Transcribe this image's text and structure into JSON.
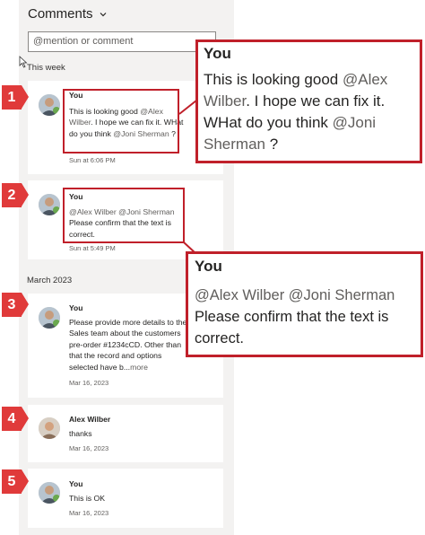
{
  "header": {
    "title": "Comments",
    "chevron_icon": "chevron-down-icon"
  },
  "search": {
    "placeholder": "@mention or comment"
  },
  "sections": {
    "this_week": "This week",
    "march_2023": "March 2023"
  },
  "comments": [
    {
      "badge": "1",
      "author": "You",
      "text_before": "This is looking good ",
      "mention1": "@Alex Wilber",
      "text_middle": ". I hope we can fix it. WHat do you think ",
      "mention2": "@Joni Sherman",
      "text_after": " ?",
      "time": "Sun at 6:06 PM"
    },
    {
      "badge": "2",
      "author": "You",
      "mention1": "@Alex Wilber",
      "mention2": "@Joni Sherman",
      "text_after": "Please confirm that the text is correct.",
      "time": "Sun at 5:49 PM"
    },
    {
      "badge": "3",
      "author": "You",
      "text": "Please provide more details to the Sales team about the customers pre-order #1234cCD. Other than that the record and options selected have b...",
      "more": "more",
      "time": "Mar 16, 2023"
    },
    {
      "badge": "4",
      "author": "Alex Wilber",
      "text": "thanks",
      "time": "Mar 16, 2023"
    },
    {
      "badge": "5",
      "author": "You",
      "text": "This is OK",
      "time": "Mar 16, 2023"
    }
  ],
  "zoom1": {
    "author": "You",
    "text_before": "This is looking good ",
    "mention1": "@Alex Wilber",
    "text_middle": ". I hope we can fix it. WHat do you think ",
    "mention2": "@Joni Sherman",
    "text_after": " ?"
  },
  "zoom2": {
    "author": "You",
    "mention1": "@Alex Wilber",
    "mention2": "@Joni Sherman",
    "text_after": "Please confirm that the text is correct."
  },
  "colors": {
    "highlight": "#c0202a",
    "badge": "#e03a3a",
    "panel": "#f3f2f1",
    "mention": "#605e5c"
  }
}
